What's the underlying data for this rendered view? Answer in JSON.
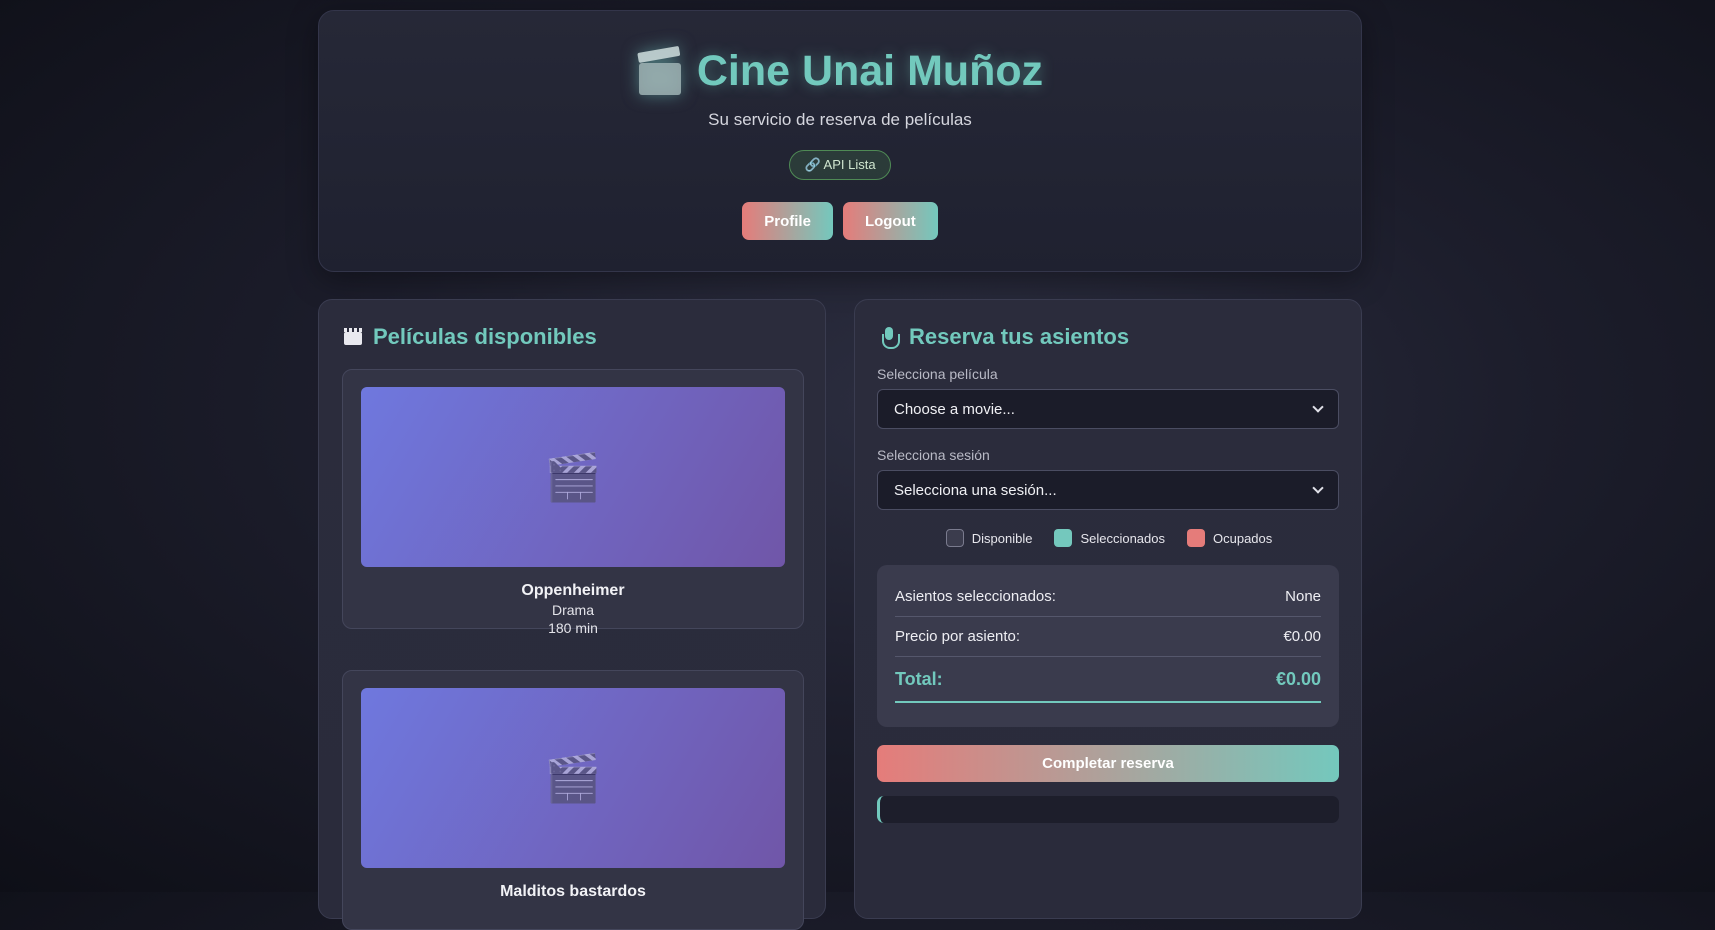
{
  "header": {
    "title": "Cine Unai Muñoz",
    "subtitle": "Su servicio de reserva de películas",
    "api_status": "🔗 API Lista",
    "profile_label": "Profile",
    "logout_label": "Logout"
  },
  "movies_panel": {
    "title": "Películas disponibles",
    "movies": [
      {
        "name": "Oppenheimer",
        "genre": "Drama",
        "duration": "180 min"
      },
      {
        "name": "Malditos bastardos",
        "genre": "",
        "duration": ""
      }
    ]
  },
  "booking_panel": {
    "title": "Reserva tus asientos",
    "movie_label": "Selecciona película",
    "movie_select_value": "Choose a movie...",
    "session_label": "Selecciona sesión",
    "session_select_value": "Selecciona una sesión...",
    "legend": {
      "available": "Disponible",
      "selected": "Seleccionados",
      "occupied": "Ocupados"
    },
    "summary": {
      "seats_label": "Asientos seleccionados:",
      "seats_value": "None",
      "price_label": "Precio por asiento:",
      "price_value": "€0.00",
      "total_label": "Total:",
      "total_value": "€0.00"
    },
    "complete_label": "Completar reserva"
  },
  "colors": {
    "accent": "#72c9bd",
    "coral": "#e57c7a",
    "poster_gradient_start": "#6f78de",
    "poster_gradient_end": "#7056a8"
  }
}
